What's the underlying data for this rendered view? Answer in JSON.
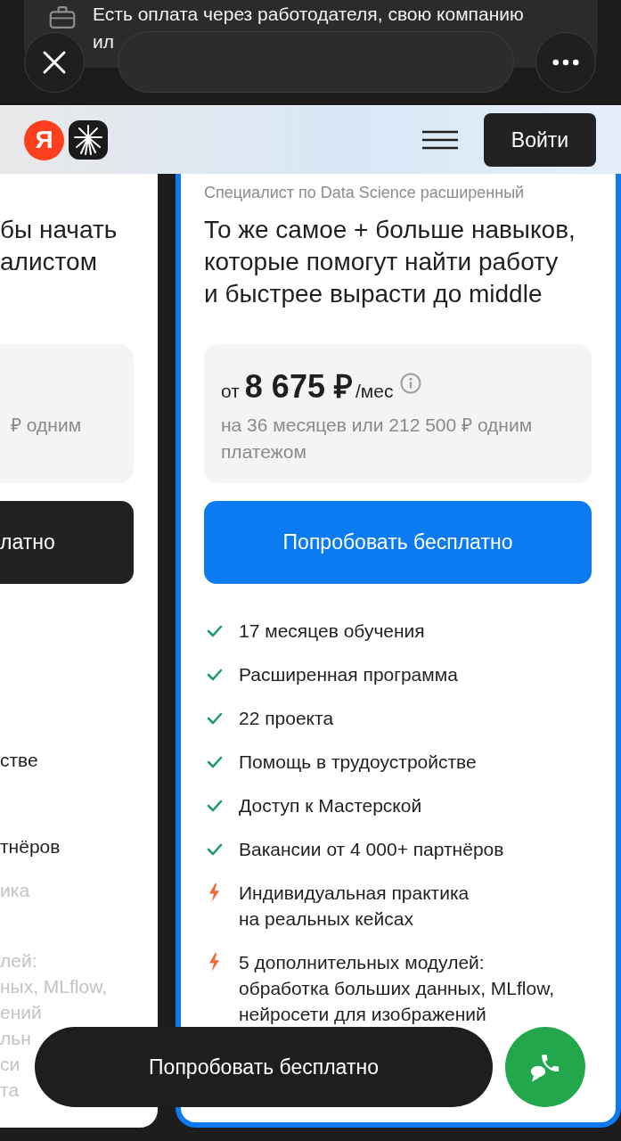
{
  "notification": {
    "text": "Есть оплата через работодателя, свою компанию\nил"
  },
  "header": {
    "logo_letter": "Я",
    "login_button": "Войти"
  },
  "left_card": {
    "title": "бы начать\nалистом",
    "price_note": "₽ одним",
    "cta": "латно",
    "features": [
      {
        "text": "стве",
        "included": true
      },
      {
        "text": "тнёров",
        "included": true
      },
      {
        "text": "ика",
        "included": false
      },
      {
        "text": "лей:\nных, MLflow,\nений\nльн\nси\nта",
        "included": false
      }
    ]
  },
  "plan_card": {
    "name": "Специалист по Data Science расширенный",
    "title": "То же самое + больше навыков,\nкоторые помогут найти работу\nи быстрее вырасти до middle",
    "price": {
      "prefix": "от",
      "value": "8 675 ₽",
      "unit": "/мес",
      "note": "на 36 месяцев или 212 500 ₽ одним\nплатежом"
    },
    "cta": "Попробовать бесплатно",
    "features": [
      {
        "kind": "check",
        "text": "17 месяцев обучения"
      },
      {
        "kind": "check",
        "text": "Расширенная программа"
      },
      {
        "kind": "check",
        "text": "22 проекта"
      },
      {
        "kind": "check",
        "text": "Помощь в трудоустройстве"
      },
      {
        "kind": "check",
        "text": "Доступ к Мастерской"
      },
      {
        "kind": "check",
        "text": "Вакансии от 4 000+ партнёров"
      },
      {
        "kind": "bolt",
        "text": "Индивидуальная практика\nна реальных кейсах"
      },
      {
        "kind": "bolt",
        "text": "5 дополнительных модулей:\nобработка больших данных, MLflow,\nнейросети для изображений"
      }
    ]
  },
  "sticky_bar": {
    "cta": "Попробовать бесплатно"
  }
}
